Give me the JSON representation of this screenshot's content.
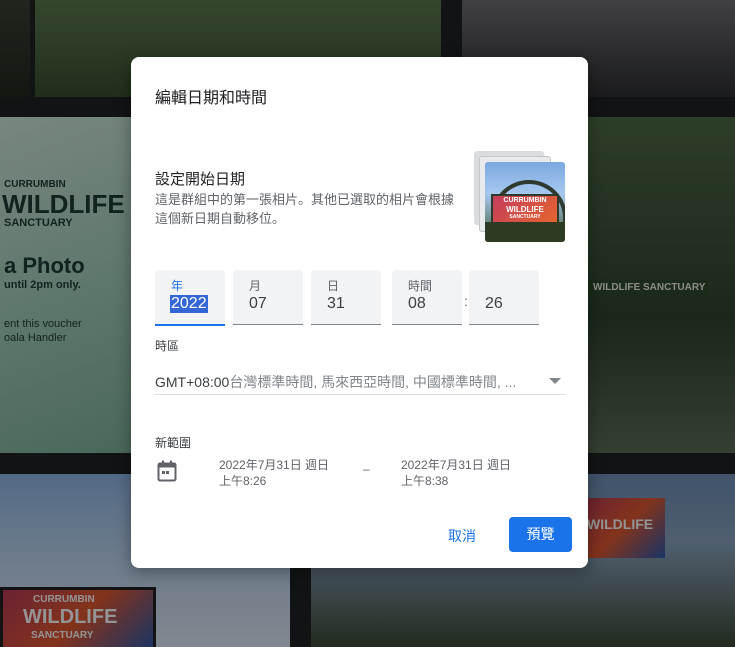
{
  "backdrop": {
    "sign_line1": "CURRUMBIN",
    "sign_line2": "WILDLIFE",
    "sign_line3": "SANCTUARY",
    "sign_photo": "a Photo",
    "sign_until": "until 2pm only.",
    "sign_voucher": "ent this voucher",
    "sign_handler": "oala Handler",
    "sanctuary_sign": "WILDLIFE SANCTUARY",
    "banner_top": "CURRUMBIN",
    "banner_mid": "WILDLIFE",
    "banner_bottom": "SANCTUARY",
    "banner_right": "WILDLIFE"
  },
  "dialog": {
    "title": "編輯日期和時間",
    "subtitle": "設定開始日期",
    "description": "這是群組中的第一張相片。其他已選取的相片會根據這個新日期自動移位。",
    "thumbnail": {
      "sign_line1": "CURRUMBIN",
      "sign_line2": "WILDLIFE",
      "sign_line3": "SANCTUARY"
    },
    "fields": [
      {
        "label": "年",
        "value": "2022",
        "active": true
      },
      {
        "label": "月",
        "value": "07"
      },
      {
        "label": "日",
        "value": "31"
      },
      {
        "label": "時間",
        "value": "08"
      },
      {
        "label": "",
        "value": "26"
      }
    ],
    "time_separator": ":",
    "timezone": {
      "label": "時區",
      "offset": "GMT+08:00",
      "names": "台灣標準時間, 馬來西亞時間, 中國標準時間, ..."
    },
    "new_range": {
      "label": "新範圍",
      "start_date": "2022年7月31日 週日",
      "start_time": "上午8:26",
      "separator": "–",
      "end_date": "2022年7月31日 週日",
      "end_time": "上午8:38"
    },
    "cancel_label": "取消",
    "preview_label": "預覽"
  },
  "colors": {
    "accent": "#1a73e8",
    "field_bg": "#f1f3f4",
    "selection": "#3367d6"
  },
  "icons": [
    "calendar-icon",
    "dropdown-arrow-icon"
  ]
}
